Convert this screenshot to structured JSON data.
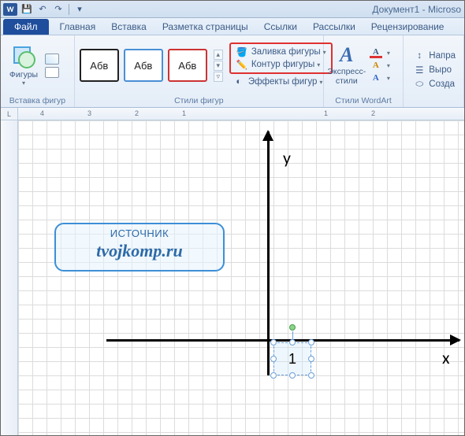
{
  "titlebar": {
    "title_text": "Документ1 - Microso",
    "app_letter": "W"
  },
  "qat": {
    "save": "💾",
    "undo": "↶",
    "redo": "↷",
    "more": "▾"
  },
  "tabs": {
    "file": "Файл",
    "items": [
      "Главная",
      "Вставка",
      "Разметка страницы",
      "Ссылки",
      "Рассылки",
      "Рецензирование"
    ]
  },
  "ribbon": {
    "group_insert": {
      "label": "Вставка фигур",
      "shapes_btn": "Фигуры"
    },
    "group_styles": {
      "label": "Стили фигур",
      "sample_text": "Абв",
      "fill": "Заливка фигуры",
      "outline": "Контур фигуры",
      "effects": "Эффекты фигур"
    },
    "group_wordart": {
      "label": "Стили WordArt",
      "express": "Экспресс-\nстили",
      "letter": "А"
    },
    "group_right": {
      "dir": "Напра",
      "align": "Выро",
      "create": "Созда"
    }
  },
  "ruler": {
    "ticks": [
      "4",
      "3",
      "2",
      "1",
      "",
      "1",
      "2"
    ],
    "corner": "L"
  },
  "canvas": {
    "y_label": "y",
    "x_label": "x",
    "textbox_value": "1",
    "watermark_top": "ИСТОЧНИК",
    "watermark_bottom": "tvojkomp.ru"
  }
}
